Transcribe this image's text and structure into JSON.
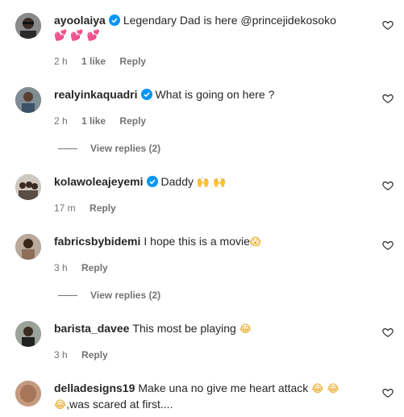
{
  "comments": [
    {
      "username": "ayoolaiya",
      "verified": true,
      "text": "Legendary Dad is here @princejidekosoko",
      "emoji": "💕 💕 💕",
      "time": "2 h",
      "likes": "1 like",
      "reply": "Reply"
    },
    {
      "username": "realyinkaquadri",
      "verified": true,
      "text": "What is going on here ?",
      "time": "2 h",
      "likes": "1 like",
      "reply": "Reply",
      "view_replies": "View replies (2)"
    },
    {
      "username": "kolawoleajeyemi",
      "verified": true,
      "text": "Daddy",
      "emoji": "🙌 🙌",
      "time": "17 m",
      "reply": "Reply"
    },
    {
      "username": "fabricsbybidemi",
      "verified": false,
      "text": "I hope this is a movie",
      "emoji": "😱",
      "time": "3 h",
      "reply": "Reply",
      "view_replies": "View replies (2)"
    },
    {
      "username": "barista_davee",
      "verified": false,
      "text": "This most be playing",
      "emoji": "😂",
      "time": "3 h",
      "reply": "Reply"
    },
    {
      "username": "delladesigns19",
      "verified": false,
      "text": "Make una no give me heart attack",
      "emoji": "😂 😂",
      "text2_emoji": "😂",
      "text2": ",was scared at first....",
      "time": "",
      "reply": ""
    }
  ],
  "colors": {
    "text": "#262626",
    "secondary": "#737373",
    "verified_blue": "#0095f6"
  }
}
